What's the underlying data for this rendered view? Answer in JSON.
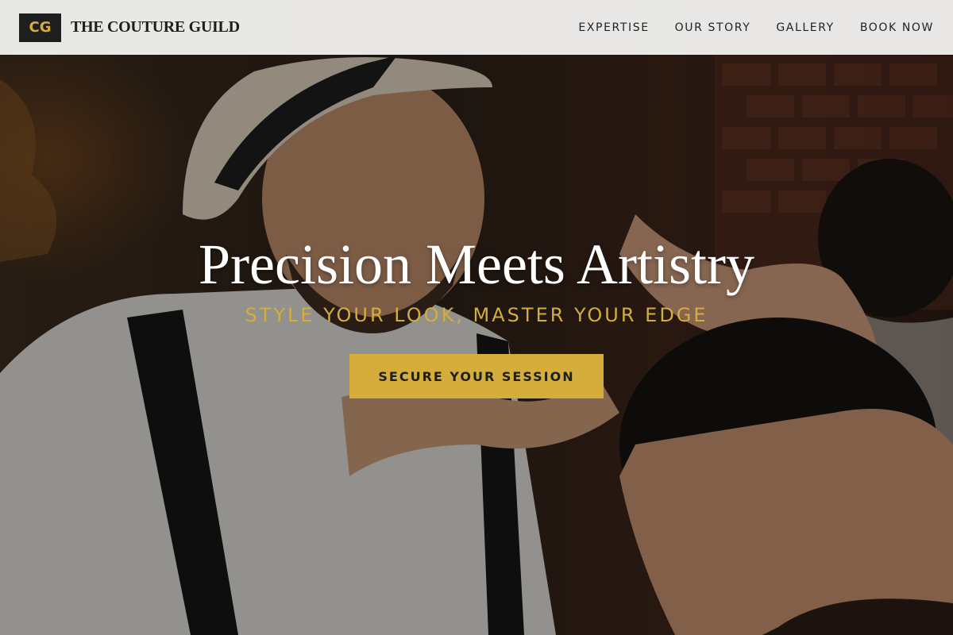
{
  "header": {
    "logo_mark": "CG",
    "brand_name": "THE COUTURE GUILD",
    "nav": [
      {
        "label": "EXPERTISE"
      },
      {
        "label": "OUR STORY"
      },
      {
        "label": "GALLERY"
      },
      {
        "label": "BOOK NOW"
      }
    ]
  },
  "hero": {
    "title": "Precision Meets Artistry",
    "subtitle": "STYLE YOUR LOOK, MASTER YOUR EDGE",
    "cta_label": "SECURE YOUR SESSION",
    "background": "barber-cutting-hair-photo"
  },
  "colors": {
    "accent_gold": "#d4ad3b",
    "header_bg": "#f0f0ee",
    "logo_bg": "#1e1e1e",
    "title_text": "#ffffff"
  }
}
